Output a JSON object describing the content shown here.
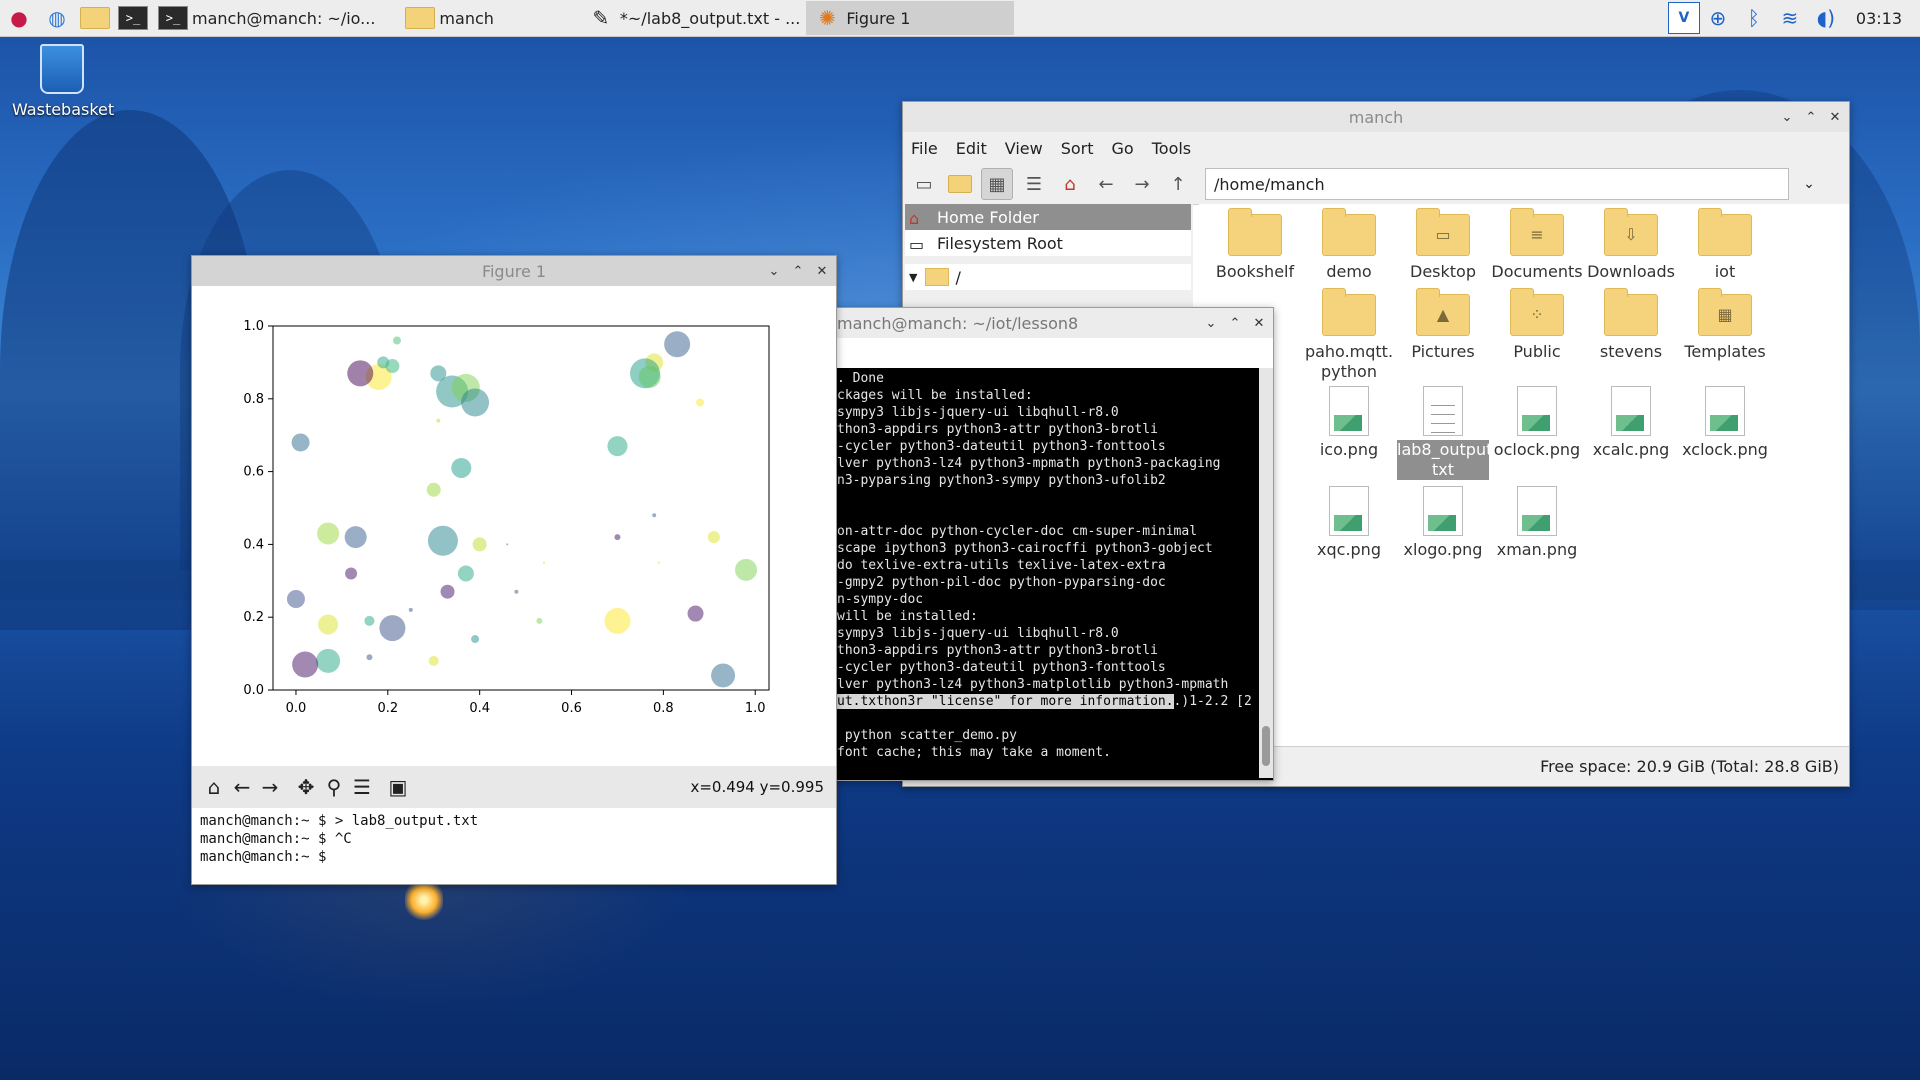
{
  "taskbar": {
    "tasks": [
      {
        "label": "manch@manch: ~/io...",
        "icon": "terminal-icon"
      },
      {
        "label": "manch",
        "icon": "folder-icon"
      },
      {
        "label": "*~/lab8_output.txt - ...",
        "icon": "text-editor-icon"
      },
      {
        "label": "Figure 1",
        "icon": "matplotlib-icon"
      }
    ],
    "clock": "03:13"
  },
  "desktop": {
    "wastebasket_label": "Wastebasket"
  },
  "file_manager": {
    "title": "manch",
    "menu": [
      "File",
      "Edit",
      "View",
      "Sort",
      "Go",
      "Tools"
    ],
    "path": "/home/manch",
    "sidebar": [
      "Home Folder",
      "Filesystem Root"
    ],
    "tree_root": "/",
    "items": [
      {
        "label": "Bookshelf",
        "kind": "folder"
      },
      {
        "label": "demo",
        "kind": "folder"
      },
      {
        "label": "Desktop",
        "kind": "folder-desktop"
      },
      {
        "label": "Documents",
        "kind": "folder-documents"
      },
      {
        "label": "Downloads",
        "kind": "folder-downloads"
      },
      {
        "label": "iot",
        "kind": "folder"
      },
      {
        "label": "paho.mqtt.\npython",
        "kind": "folder"
      },
      {
        "label": "Pictures",
        "kind": "folder-pictures"
      },
      {
        "label": "Public",
        "kind": "folder-public"
      },
      {
        "label": "stevens",
        "kind": "folder"
      },
      {
        "label": "Templates",
        "kind": "folder-templates"
      },
      {
        "label": "ico.png",
        "kind": "image"
      },
      {
        "label": "lab8_output.\ntxt",
        "kind": "text",
        "selected": true
      },
      {
        "label": "oclock.png",
        "kind": "image"
      },
      {
        "label": "xcalc.png",
        "kind": "image"
      },
      {
        "label": "xclock.png",
        "kind": "image"
      },
      {
        "label": "xqc.png",
        "kind": "image"
      },
      {
        "label": "xlogo.png",
        "kind": "image"
      },
      {
        "label": "xman.png",
        "kind": "image"
      }
    ],
    "hidden_partial_label": "q",
    "status": "Free space: 20.9 GiB (Total: 28.8 GiB)"
  },
  "terminal": {
    "title": "manch@manch: ~/iot/lesson8",
    "lines": [
      ". Done",
      "ckages will be installed:",
      "sympy3 libjs-jquery-ui libqhull-r8.0",
      "thon3-appdirs python3-attr python3-brotli",
      "-cycler python3-dateutil python3-fonttools",
      "lver python3-lz4 python3-mpmath python3-packaging",
      "n3-pyparsing python3-sympy python3-ufolib2",
      "",
      "",
      "on-attr-doc python-cycler-doc cm-super-minimal",
      "scape ipython3 python3-cairocffi python3-gobject",
      "do texlive-extra-utils texlive-latex-extra",
      "-gmpy2 python-pil-doc python-pyparsing-doc",
      "n-sympy-doc",
      "will be installed:",
      "sympy3 libjs-jquery-ui libqhull-r8.0",
      "thon3-appdirs python3-attr python3-brotli",
      "-cycler python3-dateutil python3-fonttools",
      "lver python3-lz4 python3-matplotlib python3-mpmath"
    ],
    "highlight_line": "ut.txthon3r \"license\" for more information.",
    "highlight_tail": ".)1-2.2 [2",
    "lines_after": [
      "",
      " python scatter_demo.py",
      "font cache; this may take a moment."
    ]
  },
  "figure": {
    "title": "Figure 1",
    "coords": "x=0.494 y=0.995",
    "console": [
      "manch@manch:~ $ > lab8_output.txt",
      "manch@manch:~ $ ^C",
      "manch@manch:~ $ "
    ]
  },
  "chart_data": {
    "type": "scatter",
    "title": "",
    "xlabel": "",
    "ylabel": "",
    "xlim": [
      -0.05,
      1.03
    ],
    "ylim": [
      0.0,
      1.0
    ],
    "xticks": [
      "0.0",
      "0.2",
      "0.4",
      "0.6",
      "0.8",
      "1.0"
    ],
    "yticks": [
      "0.0",
      "0.2",
      "0.4",
      "0.6",
      "0.8",
      "1.0"
    ],
    "colormap": "viridis",
    "alpha": 0.5,
    "points": [
      {
        "x": 0.83,
        "y": 0.95,
        "s": 13,
        "c": 0.3
      },
      {
        "x": 0.78,
        "y": 0.9,
        "s": 9,
        "c": 0.95
      },
      {
        "x": 0.76,
        "y": 0.87,
        "s": 15,
        "c": 0.55
      },
      {
        "x": 0.77,
        "y": 0.86,
        "s": 11,
        "c": 0.75
      },
      {
        "x": 0.88,
        "y": 0.79,
        "s": 4,
        "c": 1.0
      },
      {
        "x": 0.22,
        "y": 0.96,
        "s": 4,
        "c": 0.7
      },
      {
        "x": 0.18,
        "y": 0.86,
        "s": 13,
        "c": 1.0
      },
      {
        "x": 0.14,
        "y": 0.87,
        "s": 13,
        "c": 0.0
      },
      {
        "x": 0.19,
        "y": 0.9,
        "s": 6,
        "c": 0.6
      },
      {
        "x": 0.21,
        "y": 0.89,
        "s": 7,
        "c": 0.65
      },
      {
        "x": 0.31,
        "y": 0.87,
        "s": 8,
        "c": 0.5
      },
      {
        "x": 0.34,
        "y": 0.82,
        "s": 16,
        "c": 0.5
      },
      {
        "x": 0.37,
        "y": 0.83,
        "s": 14,
        "c": 0.8
      },
      {
        "x": 0.39,
        "y": 0.79,
        "s": 14,
        "c": 0.45
      },
      {
        "x": 0.31,
        "y": 0.74,
        "s": 2,
        "c": 0.9
      },
      {
        "x": 0.01,
        "y": 0.68,
        "s": 9,
        "c": 0.35
      },
      {
        "x": 0.7,
        "y": 0.67,
        "s": 10,
        "c": 0.6
      },
      {
        "x": 0.36,
        "y": 0.61,
        "s": 10,
        "c": 0.55
      },
      {
        "x": 0.3,
        "y": 0.55,
        "s": 7,
        "c": 0.85
      },
      {
        "x": 0.78,
        "y": 0.48,
        "s": 2,
        "c": 0.3
      },
      {
        "x": 0.07,
        "y": 0.43,
        "s": 11,
        "c": 0.85
      },
      {
        "x": 0.13,
        "y": 0.42,
        "s": 11,
        "c": 0.3
      },
      {
        "x": 0.32,
        "y": 0.41,
        "s": 15,
        "c": 0.45
      },
      {
        "x": 0.4,
        "y": 0.4,
        "s": 7,
        "c": 0.9
      },
      {
        "x": 0.46,
        "y": 0.4,
        "s": 1,
        "c": 0.4
      },
      {
        "x": 0.7,
        "y": 0.42,
        "s": 3,
        "c": 0.05
      },
      {
        "x": 0.91,
        "y": 0.42,
        "s": 6,
        "c": 0.95
      },
      {
        "x": 0.37,
        "y": 0.32,
        "s": 8,
        "c": 0.6
      },
      {
        "x": 0.12,
        "y": 0.32,
        "s": 6,
        "c": 0.05
      },
      {
        "x": 0.33,
        "y": 0.27,
        "s": 7,
        "c": 0.05
      },
      {
        "x": 0.48,
        "y": 0.27,
        "s": 2,
        "c": 0.3
      },
      {
        "x": 0.54,
        "y": 0.35,
        "s": 1,
        "c": 0.9
      },
      {
        "x": 0.79,
        "y": 0.35,
        "s": 1,
        "c": 0.9
      },
      {
        "x": 0.98,
        "y": 0.33,
        "s": 11,
        "c": 0.8
      },
      {
        "x": 0.0,
        "y": 0.25,
        "s": 9,
        "c": 0.25
      },
      {
        "x": 0.25,
        "y": 0.22,
        "s": 2,
        "c": 0.25
      },
      {
        "x": 0.53,
        "y": 0.19,
        "s": 3,
        "c": 0.8
      },
      {
        "x": 0.07,
        "y": 0.18,
        "s": 10,
        "c": 0.95
      },
      {
        "x": 0.16,
        "y": 0.19,
        "s": 5,
        "c": 0.6
      },
      {
        "x": 0.21,
        "y": 0.17,
        "s": 13,
        "c": 0.25
      },
      {
        "x": 0.39,
        "y": 0.14,
        "s": 4,
        "c": 0.5
      },
      {
        "x": 0.7,
        "y": 0.19,
        "s": 13,
        "c": 1.0
      },
      {
        "x": 0.87,
        "y": 0.21,
        "s": 8,
        "c": 0.05
      },
      {
        "x": 0.16,
        "y": 0.09,
        "s": 3,
        "c": 0.25
      },
      {
        "x": 0.07,
        "y": 0.08,
        "s": 12,
        "c": 0.6
      },
      {
        "x": 0.02,
        "y": 0.07,
        "s": 13,
        "c": 0.05
      },
      {
        "x": 0.3,
        "y": 0.08,
        "s": 5,
        "c": 0.95
      },
      {
        "x": 0.93,
        "y": 0.04,
        "s": 12,
        "c": 0.35
      }
    ]
  }
}
